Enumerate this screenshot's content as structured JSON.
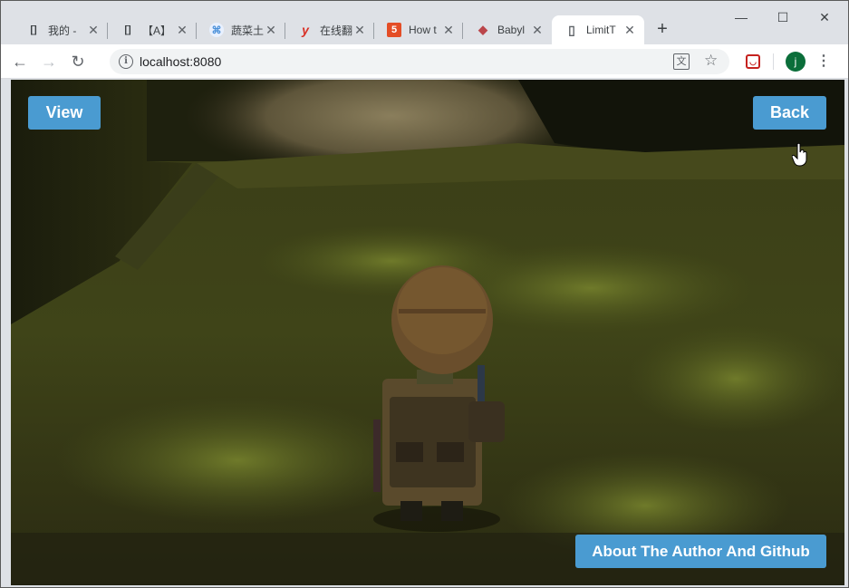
{
  "browser": {
    "tabs": [
      {
        "title": "我的 -",
        "favicon": "brackets-icon",
        "favicon_glyph": "[]"
      },
      {
        "title": "【A】",
        "favicon": "brackets-icon",
        "favicon_glyph": "[]"
      },
      {
        "title": "蔬菜土",
        "favicon": "leaf-icon",
        "favicon_glyph": "⌘"
      },
      {
        "title": "在线翻",
        "favicon": "y-logo-icon",
        "favicon_glyph": "y"
      },
      {
        "title": "How t",
        "favicon": "html5-icon",
        "favicon_glyph": "5"
      },
      {
        "title": "Babyl",
        "favicon": "babylon-icon",
        "favicon_glyph": "◆"
      },
      {
        "title": "LimitT",
        "favicon": "page-icon",
        "favicon_glyph": "▯"
      }
    ],
    "active_tab_index": 6,
    "new_tab_symbol": "+",
    "window_controls": {
      "minimize": "—",
      "maximize": "☐",
      "close": "✕"
    },
    "url": "localhost:8080",
    "avatar_letter": "j"
  },
  "app": {
    "view_button": "View",
    "back_button": "Back",
    "about_button": "About The Author And Github",
    "accent_color": "#4a9bd1"
  }
}
